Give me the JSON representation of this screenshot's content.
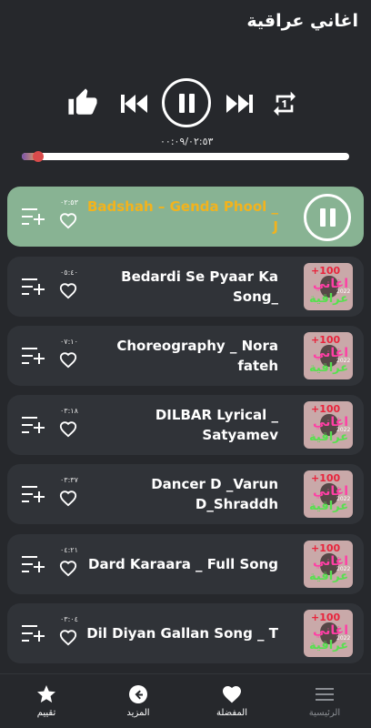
{
  "app": {
    "title": "اغاني عراقية"
  },
  "player": {
    "time_readout": "٠٠:٠٩/٠٢:٥٣",
    "progress": 0.05
  },
  "songs": [
    {
      "title": "Badshah – Genda Phool _ J",
      "duration": "٠٢:٥٣",
      "active": true
    },
    {
      "title": "Bedardi Se Pyaar Ka Song_",
      "duration": "٠٥:٤٠",
      "active": false
    },
    {
      "title": "Choreography _ Nora fateh",
      "duration": "٠٧:١٠",
      "active": false
    },
    {
      "title": "DILBAR Lyrical _ Satyamev",
      "duration": "٠٣:١٨",
      "active": false
    },
    {
      "title": "Dancer D _Varun D_Shraddh",
      "duration": "٠٣:٣٧",
      "active": false
    },
    {
      "title": "Dard Karaara _ Full Song",
      "duration": "٠٤:٢١",
      "active": false
    },
    {
      "title": "Dil Diyan Gallan Song _ T",
      "duration": "٠٣:٠٤",
      "active": false
    }
  ],
  "thumbnail": {
    "line1": "+100",
    "line2": "اغاني",
    "line3": "عراقية",
    "year": "2022"
  },
  "bottom_nav": {
    "rate_label": "تقييم",
    "more_label": "المزيد",
    "favorites_label": "المفضلة",
    "home_label": "الرئيسية"
  },
  "colors": {
    "background": "#26282c",
    "row": "#303338",
    "active_row": "#88b393",
    "active_title": "#f2b31d"
  },
  "icons": [
    "thumbs-up-icon",
    "skip-previous-icon",
    "pause-icon",
    "skip-next-icon",
    "repeat-one-icon",
    "playlist-add-icon",
    "heart-outline-icon",
    "star-icon",
    "arrow-left-circle-icon",
    "heart-icon",
    "menu-icon"
  ]
}
